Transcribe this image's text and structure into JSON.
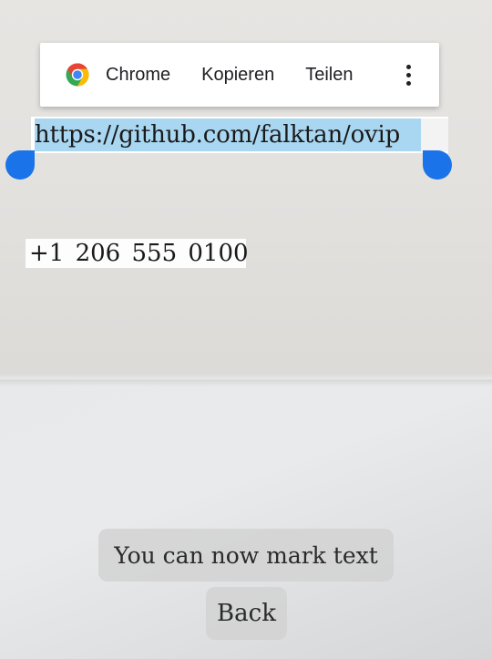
{
  "context_menu": {
    "items": [
      {
        "label": "Chrome",
        "icon": "chrome-icon"
      },
      {
        "label": "Kopieren"
      },
      {
        "label": "Teilen"
      }
    ],
    "more_icon": "more-vert-icon"
  },
  "recognized_text": {
    "url": "https://github.com/falktan/ovip",
    "phone": "+1 206 555 0100"
  },
  "hint": "You can now mark text",
  "back_label": "Back",
  "colors": {
    "selection_highlight": "#a9d6f0",
    "handle": "#1a73e8",
    "chrome_red": "#ea4335",
    "chrome_yellow": "#fbbc04",
    "chrome_green": "#34a853",
    "chrome_blue": "#4285f4"
  }
}
